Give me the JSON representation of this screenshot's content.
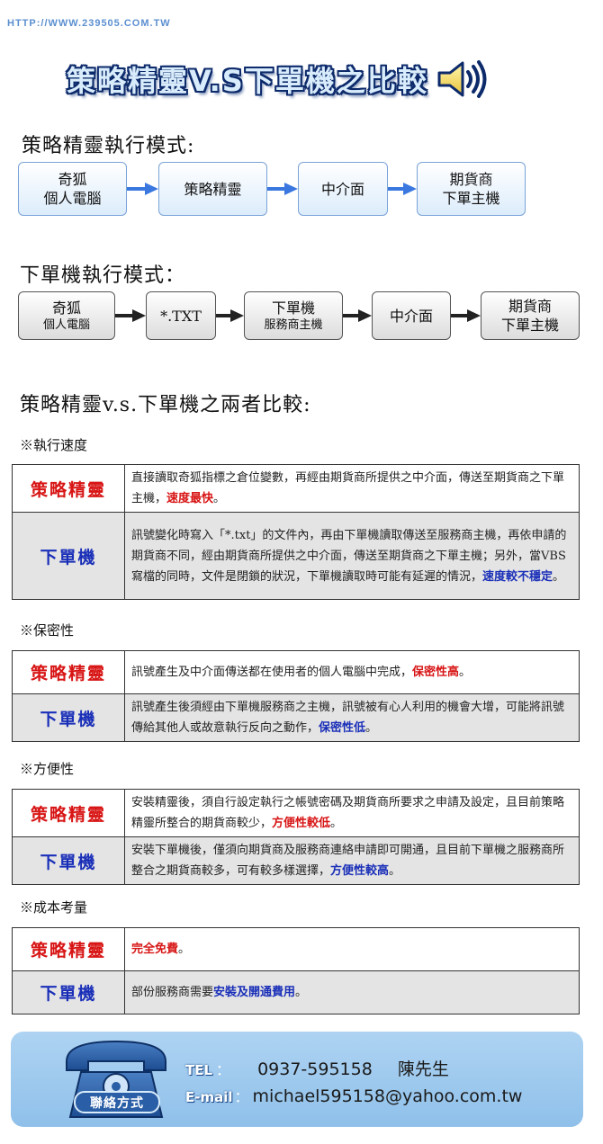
{
  "header": {
    "url": "HTTP://WWW.239505.COM.TW",
    "banner_title": "策略精靈V.S下單機之比較"
  },
  "section1": {
    "title": "策略精靈執行模式:",
    "flow": [
      {
        "line1": "奇狐",
        "line2": "個人電腦"
      },
      {
        "line1": "策略精靈",
        "line2": ""
      },
      {
        "line1": "中介面",
        "line2": ""
      },
      {
        "line1": "期貨商",
        "line2": "下單主機"
      }
    ]
  },
  "section2": {
    "title": "下單機執行模式：",
    "flow": [
      {
        "line1": "奇狐",
        "line2": "個人電腦"
      },
      {
        "line1": "*.TXT",
        "line2": ""
      },
      {
        "line1": "下單機",
        "line2": "服務商主機"
      },
      {
        "line1": "中介面",
        "line2": ""
      },
      {
        "line1": "期貨商",
        "line2": "下單主機"
      }
    ]
  },
  "compare_title": "策略精靈v.s.下單機之兩者比較:",
  "sections": [
    {
      "heading": "※執行速度",
      "rows": [
        {
          "label": "策略精靈",
          "text": "直接讀取奇狐指標之倉位變數，再經由期貨商所提供之中介面，傳送至期貨商之下單主機，",
          "highlight": "速度最快",
          "tail": "。"
        },
        {
          "label": "下單機",
          "text": "訊號變化時寫入「*.txt」的文件內，再由下單機讀取傳送至服務商主機，再依申請的期貨商不同，經由期貨商所提供之中介面，傳送至期貨商之下單主機；另外，當VBS寫檔的同時，文件是閉鎖的狀況，下單機讀取時可能有延遲的情況，",
          "highlight": "速度較不穩定",
          "tail": "。"
        }
      ]
    },
    {
      "heading": "※保密性",
      "rows": [
        {
          "label": "策略精靈",
          "text": "訊號產生及中介面傳送都在使用者的個人電腦中完成，",
          "highlight": "保密性高",
          "tail": "。"
        },
        {
          "label": "下單機",
          "text": "訊號產生後須經由下單機服務商之主機，訊號被有心人利用的機會大增，可能將訊號傳給其他人或故意執行反向之動作，",
          "highlight": "保密性低",
          "tail": "。"
        }
      ]
    },
    {
      "heading": "※方便性",
      "rows": [
        {
          "label": "策略精靈",
          "text": "安裝精靈後，須自行設定執行之帳號密碼及期貨商所要求之申請及設定，且目前策略精靈所整合的期貨商較少，",
          "highlight": "方便性較低",
          "tail": "。"
        },
        {
          "label": "下單機",
          "text": "安裝下單機後，僅須向期貨商及服務商連絡申請即可開通，且目前下單機之服務商所整合之期貨商較多，可有較多樣選擇，",
          "highlight": "方便性較高",
          "tail": "。"
        }
      ]
    },
    {
      "heading": "※成本考量",
      "rows": [
        {
          "label": "策略精靈",
          "text": "",
          "highlight": "完全免費",
          "tail": "。"
        },
        {
          "label": "下單機",
          "text": "部份服務商需要",
          "highlight": "安裝及開通費用",
          "tail": "。"
        }
      ]
    }
  ],
  "contact": {
    "badge": "聯絡方式",
    "tel_label": "TEL",
    "tel_sep": "：",
    "tel_value": "0937-595158",
    "tel_name": "陳先生",
    "email_label": "E-mail",
    "email_sep": "：",
    "email_value": "michael595158@yahoo.com.tw"
  },
  "colors": {
    "red": "#d81515",
    "blue": "#1a2fb8",
    "flow_border_blue": "#7aa3d8",
    "arrow_blue": "#3a78e0",
    "arrow_black": "#222222"
  },
  "icons": [
    "speaker-icon",
    "telephone-icon",
    "arrow-right-icon"
  ]
}
